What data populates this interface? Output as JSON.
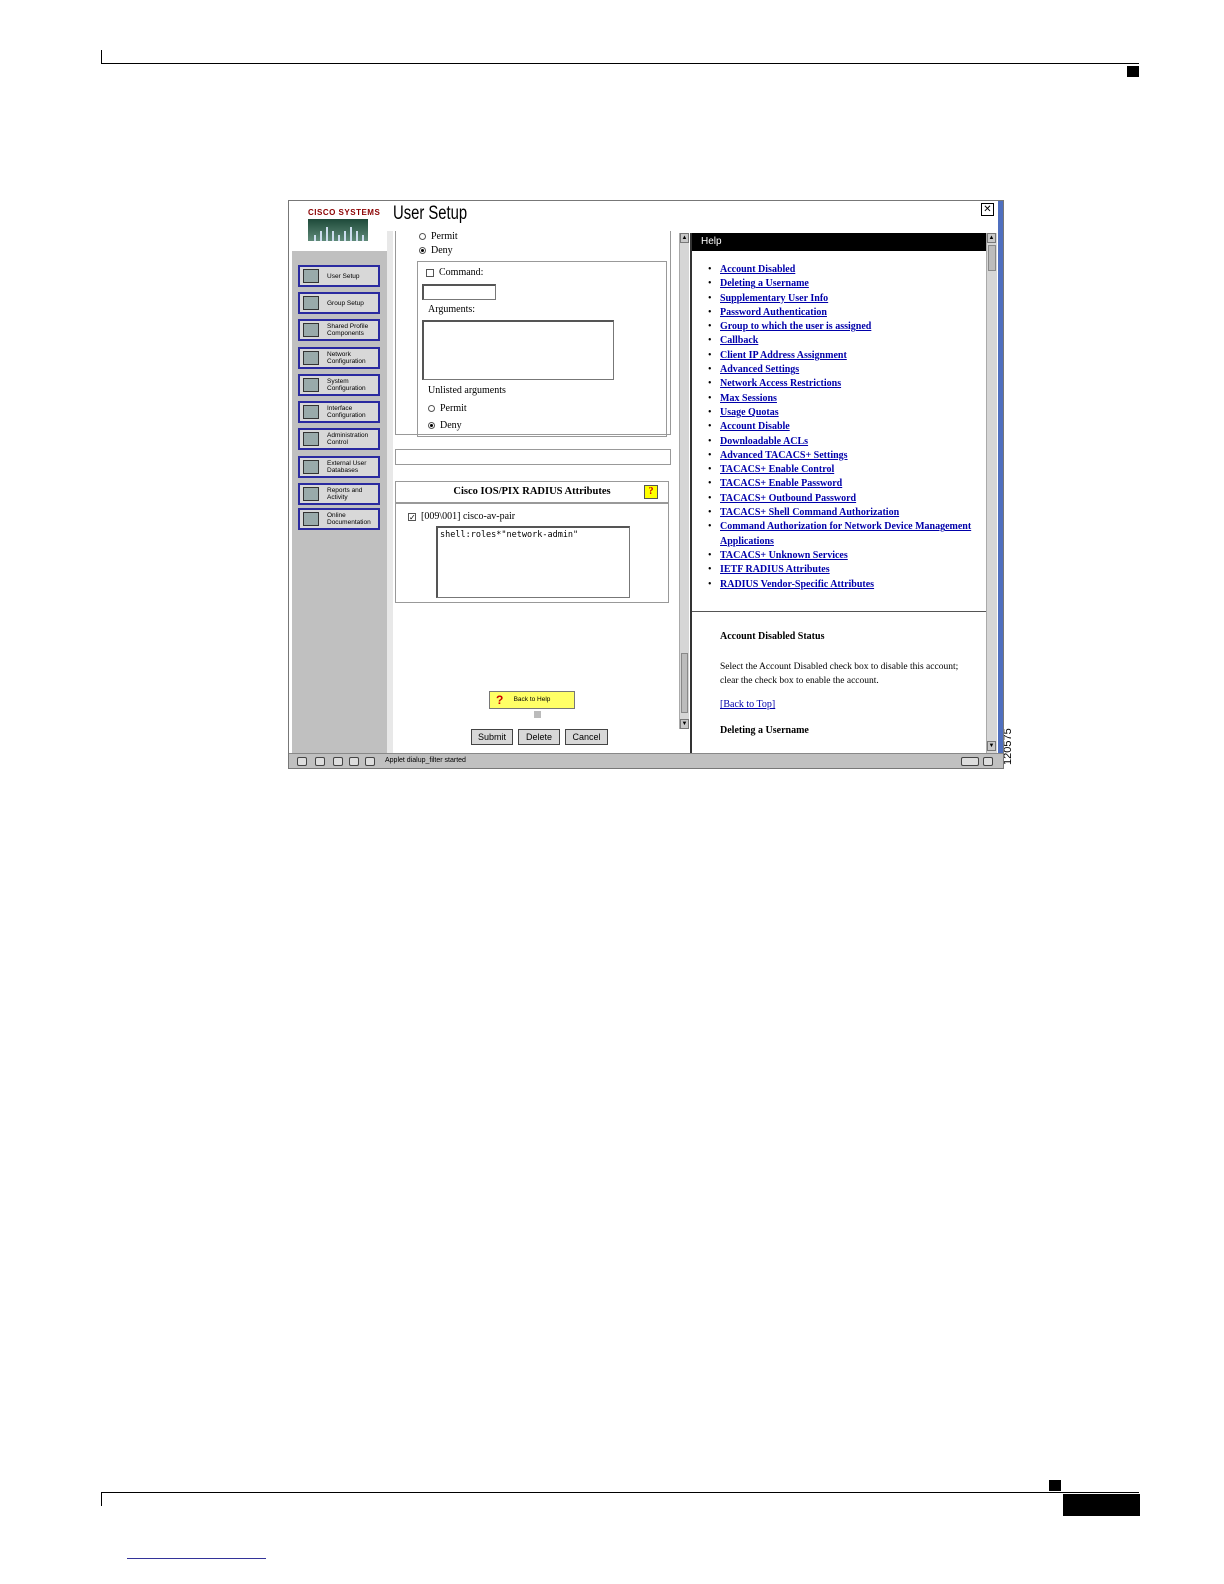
{
  "figure_id": "120575",
  "app": {
    "logo": "CISCO SYSTEMS",
    "title": "User Setup",
    "close_symbol": "✕"
  },
  "nav": [
    {
      "label": "User Setup",
      "icon": "user-setup-icon"
    },
    {
      "label": "Group Setup",
      "icon": "group-setup-icon"
    },
    {
      "label": "Shared Profile Components",
      "icon": "shared-profile-icon"
    },
    {
      "label": "Network Configuration",
      "icon": "network-config-icon"
    },
    {
      "label": "System Configuration",
      "icon": "system-config-icon"
    },
    {
      "label": "Interface Configuration",
      "icon": "interface-config-icon"
    },
    {
      "label": "Administration Control",
      "icon": "admin-control-icon"
    },
    {
      "label": "External User Databases",
      "icon": "external-db-icon"
    },
    {
      "label": "Reports and Activity",
      "icon": "reports-icon"
    },
    {
      "label": "Online Documentation",
      "icon": "online-docs-icon"
    }
  ],
  "form": {
    "permit_label": "Permit",
    "deny_label": "Deny",
    "command_label": "Command:",
    "command_value": "",
    "arguments_label": "Arguments:",
    "arguments_value": "",
    "unlisted_label": "Unlisted arguments",
    "unlisted_permit": "Permit",
    "unlisted_deny": "Deny",
    "radius_section_title": "Cisco IOS/PIX RADIUS Attributes",
    "help_q": "?",
    "avpair_label": "[009\\001] cisco-av-pair",
    "avpair_checked": "✓",
    "avpair_value": "shell:roles*\"network-admin\"",
    "back_to_help": "Back to Help",
    "submit": "Submit",
    "delete": "Delete",
    "cancel": "Cancel"
  },
  "help": {
    "header": "Help",
    "links": [
      "Account Disabled",
      "Deleting a Username",
      "Supplementary User Info",
      "Password Authentication",
      "Group to which the user is assigned",
      "Callback",
      "Client IP Address Assignment",
      "Advanced Settings",
      "Network Access Restrictions",
      "Max Sessions",
      "Usage Quotas",
      "Account Disable",
      "Downloadable ACLs",
      "Advanced TACACS+ Settings",
      "TACACS+ Enable Control",
      "TACACS+ Enable Password",
      "TACACS+ Outbound Password",
      "TACACS+ Shell Command Authorization",
      "Command Authorization for Network Device Management Applications",
      "TACACS+ Unknown Services",
      "IETF RADIUS Attributes",
      "RADIUS Vendor-Specific Attributes"
    ],
    "section_title": "Account Disabled Status",
    "section_text": "Select the Account Disabled check box to disable this account; clear the check box to enable the account.",
    "back_to_top": "[Back to Top]",
    "next_title": "Deleting a Username"
  },
  "status": {
    "text": "Applet dialup_filter started"
  }
}
